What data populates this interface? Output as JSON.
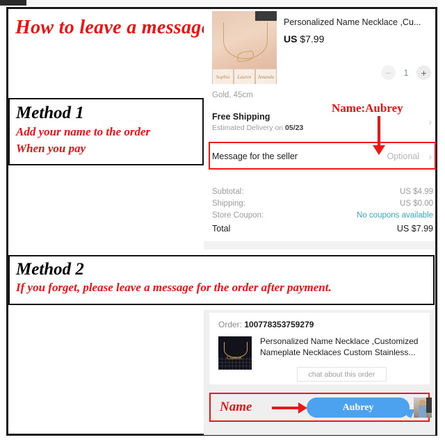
{
  "headline": "How to leave a message?",
  "method1": {
    "title": "Method 1",
    "line1": "Add your name to the order",
    "line2": "When you pay"
  },
  "method2": {
    "title": "Method 2",
    "line1": "If you forget, please leave a message for the order after payment."
  },
  "checkout": {
    "product": {
      "title": "Personalized Name Necklace ,Cu...",
      "price_currency": "US",
      "price_value": "$7.99",
      "variant": "Gold, 45cm",
      "thumb_names": [
        "Sophia",
        "Lauren",
        "Amanda"
      ]
    },
    "quantity": {
      "minus_label": "−",
      "value": "1",
      "plus_label": "+"
    },
    "shipping": {
      "title": "Free Shipping",
      "estimate_prefix": "Estimated Delivery on ",
      "estimate_date": "05/23",
      "chevron": "›"
    },
    "message_row": {
      "label": "Message for the seller",
      "value": "Optional",
      "chevron": "›"
    },
    "totals": [
      {
        "label": "Subtotal:",
        "value": "US $4.99",
        "style": "normal"
      },
      {
        "label": "Shipping:",
        "value": "US $0.00",
        "style": "normal"
      },
      {
        "label": "Store Coupon:",
        "value": "No coupons available",
        "style": "coupon"
      },
      {
        "label": "Total",
        "value": "US $7.99",
        "style": "grand"
      }
    ]
  },
  "annotation_name": "Name:Aubrey",
  "order_panel": {
    "order_label_prefix": "Order: ",
    "order_number": "100778353759279",
    "item_title": "Personalized Name Necklace ,Customized Nameplate Necklaces Custom Stainless...",
    "chat_button": "chat about this order",
    "thumb_plate_text": "Custom"
  },
  "chat_strip": {
    "name_label": "Name",
    "bubble_text": "Aubrey"
  },
  "colors": {
    "annotation_red": "#ee1111",
    "box_red": "#f21515",
    "bubble_blue": "#4da2f0",
    "coupon_blue": "#3aa8c1",
    "frame_black": "#1a1a1a"
  }
}
